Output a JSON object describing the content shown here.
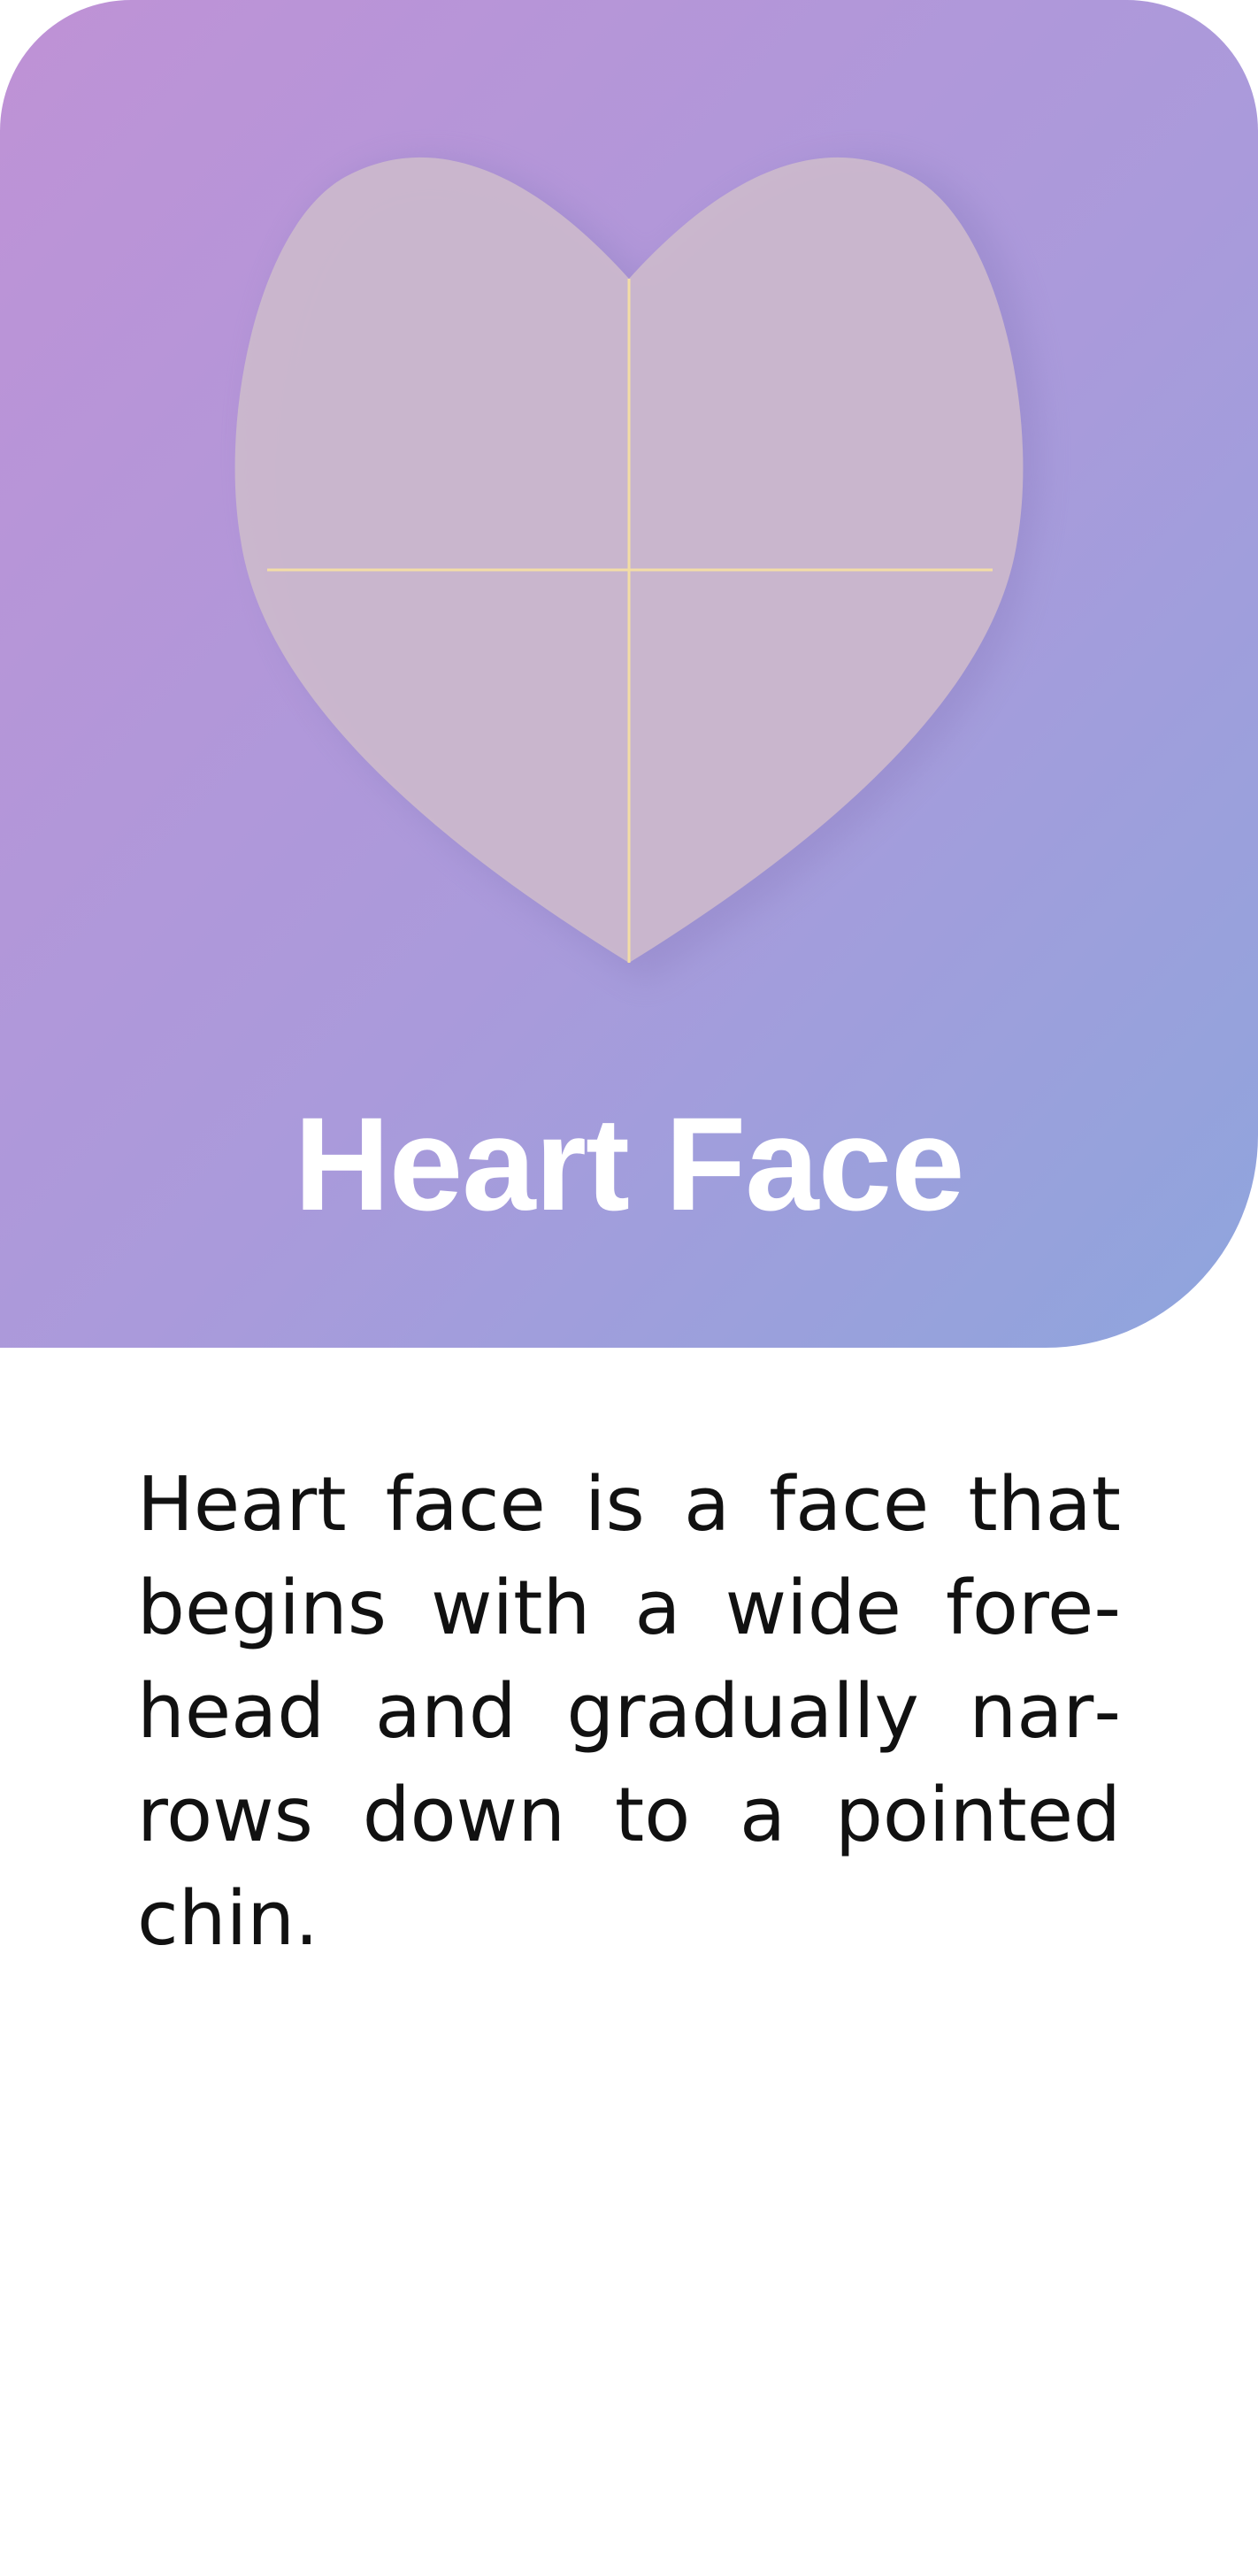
{
  "hero": {
    "title": "Heart Face",
    "colors": {
      "gradient_start": "#BF92D6",
      "gradient_mid": "#AA9ADB",
      "gradient_end": "#8EA5DD",
      "heart_fill": "#CBB8CC",
      "guide_line": "#F3DDA5"
    },
    "illustration_icon": "heart-face-shape-icon"
  },
  "description": {
    "text": "Heart face is a face that begins with a wide fore­head and gradually nar­rows down to a pointed chin."
  }
}
